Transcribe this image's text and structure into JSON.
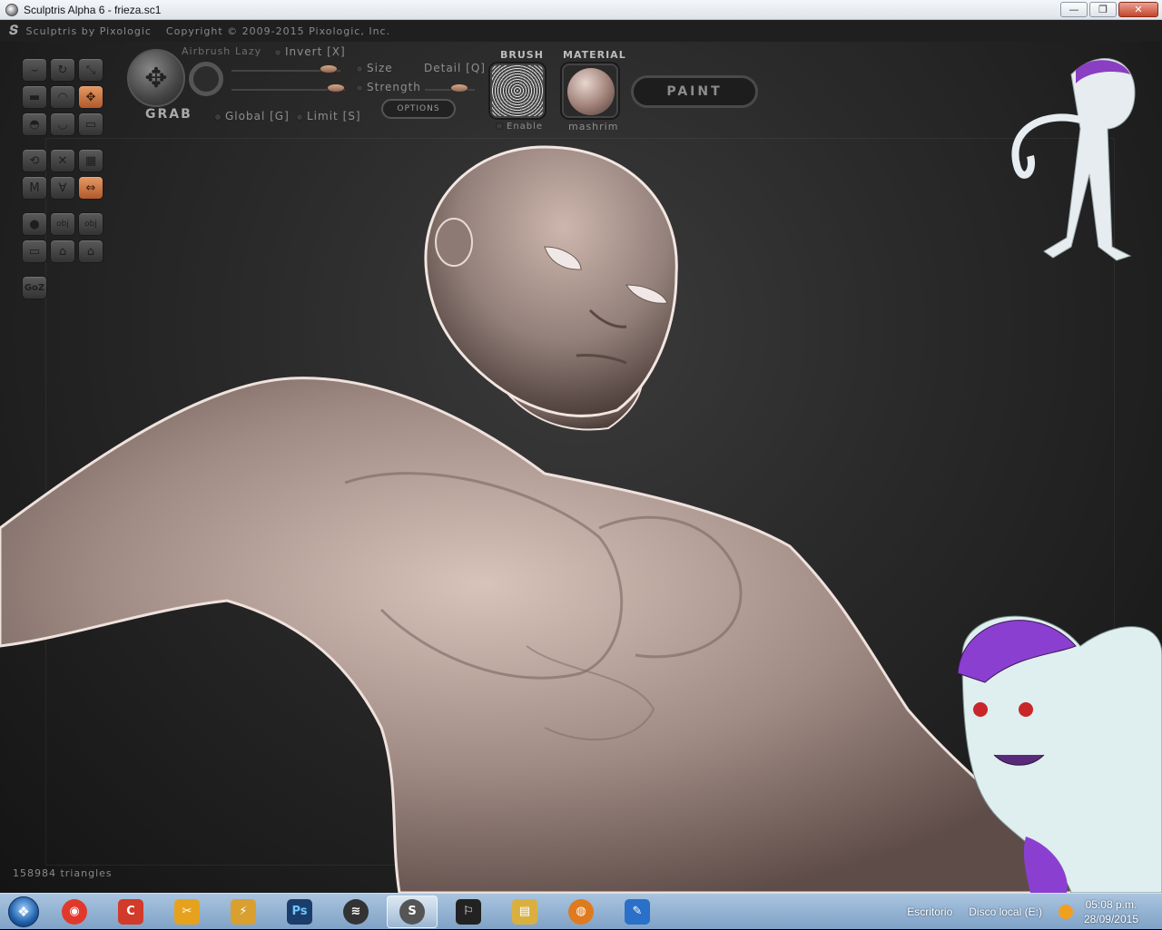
{
  "window": {
    "title": "Sculptris Alpha 6 - frieza.sc1",
    "minimize": "—",
    "maximize": "❐",
    "close": "✕"
  },
  "app_header": {
    "brand": "Sculptris by Pixologic",
    "copyright": "Copyright © 2009-2015 Pixologic, Inc."
  },
  "brush_panel": {
    "tool_name": "GRAB",
    "airbrush": "Airbrush",
    "lazy": "Lazy",
    "invert": "Invert [X]",
    "size": "Size",
    "detail": "Detail [Q]",
    "strength": "Strength",
    "global": "Global [G]",
    "limit": "Limit [S]",
    "options": "OPTIONS"
  },
  "brush_section": {
    "title": "BRUSH",
    "enable": "Enable"
  },
  "material_section": {
    "title": "MATERIAL",
    "name": "mashrim"
  },
  "paint_button": "PAINT",
  "tools": [
    {
      "name": "draw-tool-icon",
      "glyph": "⌣"
    },
    {
      "name": "rotate-tool-icon",
      "glyph": "↻"
    },
    {
      "name": "scale-tool-icon",
      "glyph": "⤡"
    },
    {
      "name": "flatten-tool-icon",
      "glyph": "▬"
    },
    {
      "name": "inflate-tool-icon",
      "glyph": "◠"
    },
    {
      "name": "grab-tool-icon",
      "glyph": "✥"
    },
    {
      "name": "pinch-tool-icon",
      "glyph": "◓"
    },
    {
      "name": "crease-tool-icon",
      "glyph": "◡"
    },
    {
      "name": "smooth-tool-icon",
      "glyph": "▭"
    },
    {
      "name": "symmetry-tool-icon",
      "glyph": "⟲"
    },
    {
      "name": "wireframe-tool-icon",
      "glyph": "✕"
    },
    {
      "name": "grid-tool-icon",
      "glyph": "▦"
    },
    {
      "name": "mask-tool-icon",
      "glyph": "M"
    },
    {
      "name": "reduce-tool-icon",
      "glyph": "∀"
    },
    {
      "name": "mirror-tool-icon",
      "glyph": "⇔"
    },
    {
      "name": "sphere-tool-icon",
      "glyph": "●"
    },
    {
      "name": "import-obj-icon",
      "glyph": "obj"
    },
    {
      "name": "export-obj-icon",
      "glyph": "obj"
    },
    {
      "name": "new-scene-icon",
      "glyph": "▭"
    },
    {
      "name": "open-file-icon",
      "glyph": "⌂"
    },
    {
      "name": "save-file-icon",
      "glyph": "⌂"
    },
    {
      "name": "goz-icon",
      "glyph": "GoZ"
    }
  ],
  "status": {
    "triangles": "158984 triangles"
  },
  "taskbar": {
    "start_glyph": "❖",
    "apps": [
      {
        "name": "chrome-icon",
        "glyph": "◉",
        "color": "#e0392b"
      },
      {
        "name": "ccleaner-icon",
        "glyph": "C",
        "color": "#d23a2a"
      },
      {
        "name": "tools-icon",
        "glyph": "✂",
        "color": "#e6a21c"
      },
      {
        "name": "winamp-icon",
        "glyph": "⚡",
        "color": "#d9a030"
      },
      {
        "name": "photoshop-icon",
        "glyph": "Ps",
        "color": "#1b3d6b"
      },
      {
        "name": "disc-app-icon",
        "glyph": "≋",
        "color": "#333"
      },
      {
        "name": "sculptris-icon",
        "glyph": "S",
        "color": "#555"
      },
      {
        "name": "zbrush-icon",
        "glyph": "⚐",
        "color": "#222"
      },
      {
        "name": "explorer-icon",
        "glyph": "▤",
        "color": "#d9b040"
      },
      {
        "name": "blender-icon",
        "glyph": "◍",
        "color": "#e07a1f"
      },
      {
        "name": "paint-app-icon",
        "glyph": "✎",
        "color": "#2a70c8"
      }
    ],
    "tray_items": [
      "Escritorio",
      "Disco local (E:)"
    ],
    "time": "05:08 p.m.",
    "date": "28/09/2015"
  }
}
